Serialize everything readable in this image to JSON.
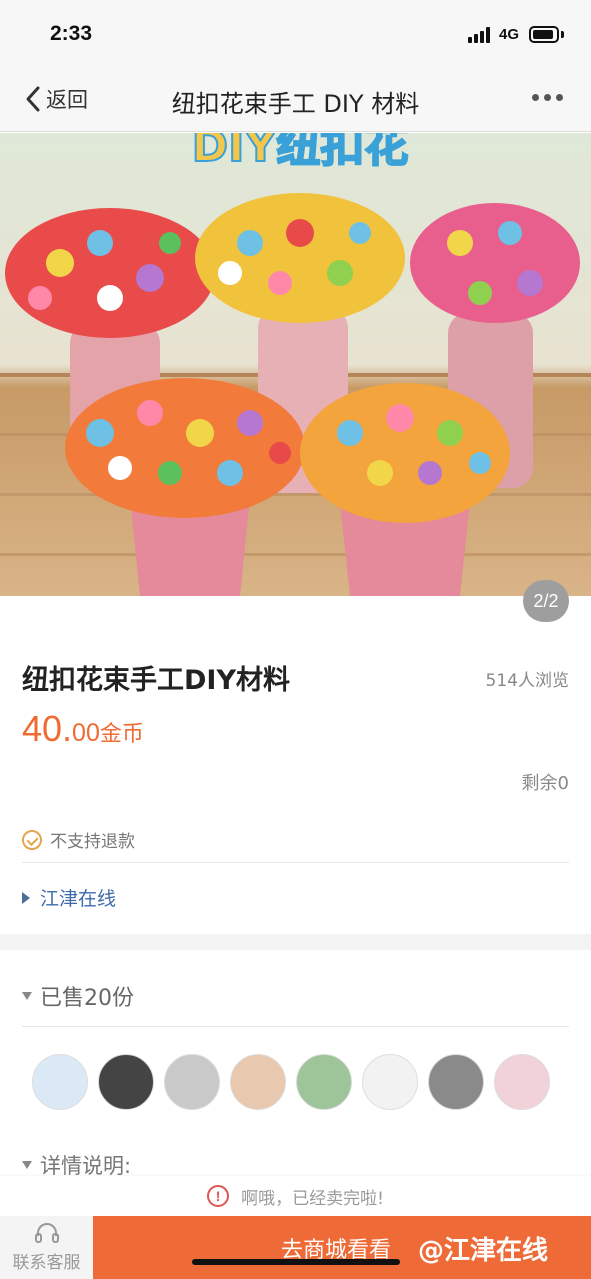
{
  "status_bar": {
    "time": "2:33",
    "network": "4G",
    "signal_icon": "signal-bars-icon",
    "battery_icon": "battery-icon"
  },
  "nav": {
    "back_label": "返回",
    "title": "纽扣花束手工 DIY 材料",
    "more_icon": "more-dots-icon"
  },
  "image": {
    "counter": "2/2",
    "banner_text": "DIY纽扣花"
  },
  "product": {
    "title": "纽扣花束手工DIY材料",
    "views": "514人浏览",
    "price_int": "40.",
    "price_dec": "00",
    "price_unit": "金币",
    "stock": "剩余0",
    "refund_note": "不支持退款",
    "shop_name": "江津在线"
  },
  "sales": {
    "sold_label": "已售20份",
    "buyers": [
      {
        "name": "avatar-cloud",
        "color": "#dbe9f7"
      },
      {
        "name": "avatar-dark",
        "color": "#444444"
      },
      {
        "name": "avatar-person",
        "color": "#c9c9c9"
      },
      {
        "name": "avatar-baby",
        "color": "#e8c9b0"
      },
      {
        "name": "avatar-rainbow",
        "color": "#9ec59a"
      },
      {
        "name": "avatar-cartoon",
        "color": "#f2f2f2"
      },
      {
        "name": "avatar-street",
        "color": "#8a8a8a"
      },
      {
        "name": "avatar-girl",
        "color": "#f0d2d8"
      }
    ]
  },
  "detail": {
    "label": "详情说明:"
  },
  "soldout": {
    "text": "啊哦，已经卖完啦!"
  },
  "bottom": {
    "service_label": "联系客服",
    "service_icon": "headset-icon",
    "mall_label": "去商城看看",
    "watermark": "@江津在线"
  },
  "colors": {
    "accent": "#ee6a37",
    "price": "#ef6b34",
    "link": "#3d6bab"
  }
}
